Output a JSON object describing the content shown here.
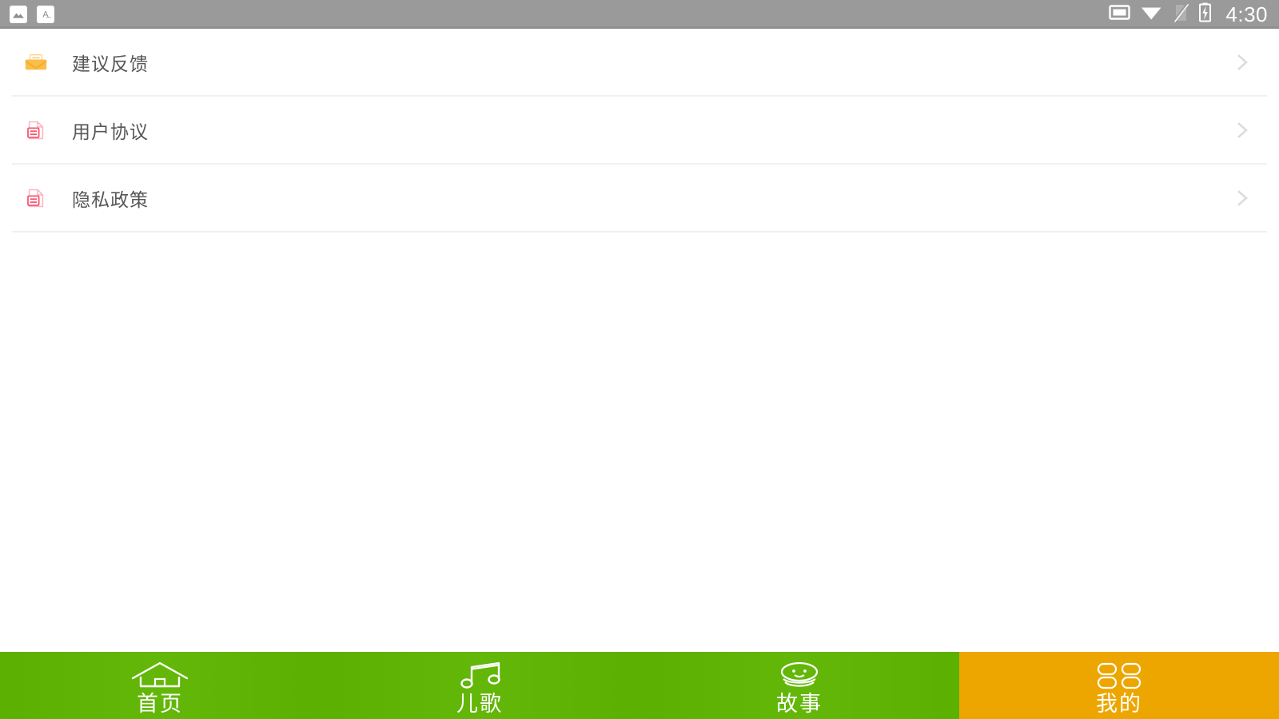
{
  "statusbar": {
    "notifications": [
      {
        "name": "image-icon",
        "label": "image"
      },
      {
        "name": "text-icon",
        "label": "A"
      }
    ],
    "icons": [
      {
        "name": "cast-screen-icon"
      },
      {
        "name": "wifi-icon"
      },
      {
        "name": "no-sim-icon"
      },
      {
        "name": "battery-charging-icon"
      }
    ],
    "time": "4:30",
    "background": "#9a9a9a"
  },
  "list": {
    "items": [
      {
        "label": "建议反馈",
        "icon": "mail-icon",
        "icon_color": "#f9bc4b",
        "chevron": "chevron-right-icon"
      },
      {
        "label": "用户协议",
        "icon": "document-icon",
        "icon_color": "#f9566e",
        "chevron": "chevron-right-icon"
      },
      {
        "label": "隐私政策",
        "icon": "document-icon",
        "icon_color": "#f9566e",
        "chevron": "chevron-right-icon"
      }
    ],
    "text_color": "#575757",
    "divider_color": "#f0f0f0"
  },
  "tabbar": {
    "active_index": 3,
    "green": "#5eb500",
    "active_color": "#eda600",
    "items": [
      {
        "label": "首页",
        "icon": "home-icon"
      },
      {
        "label": "儿歌",
        "icon": "music-note-icon"
      },
      {
        "label": "故事",
        "icon": "face-icon"
      },
      {
        "label": "我的",
        "icon": "grid-icon"
      }
    ]
  }
}
